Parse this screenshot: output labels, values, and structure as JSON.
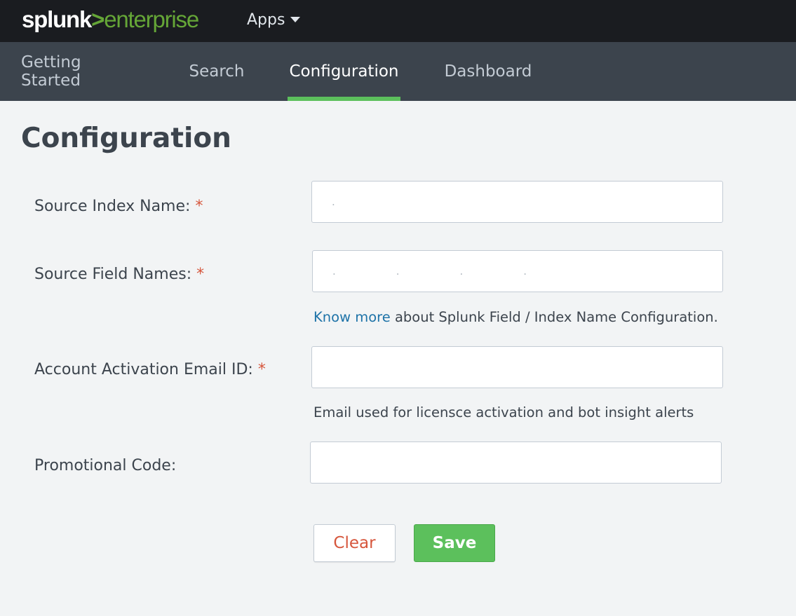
{
  "header": {
    "logo": {
      "part1": "splunk",
      "part2": ">",
      "part3": "enterprise"
    },
    "apps_label": "Apps"
  },
  "nav": {
    "tabs": [
      {
        "label": "Getting Started",
        "active": false
      },
      {
        "label": "Search",
        "active": false
      },
      {
        "label": "Configuration",
        "active": true
      },
      {
        "label": "Dashboard",
        "active": false
      }
    ]
  },
  "page": {
    "title": "Configuration"
  },
  "form": {
    "source_index": {
      "label": "Source Index Name:",
      "required_mark": "*",
      "value": "."
    },
    "source_fields": {
      "label": "Source Field Names:",
      "required_mark": "*",
      "value": "...."
    },
    "fields_help": {
      "link": "Know more",
      "text": " about Splunk Field / Index Name Configuration."
    },
    "email": {
      "label": "Account Activation Email ID:",
      "required_mark": "*",
      "value": ""
    },
    "email_help": "Email used for licensce activation and bot insight alerts",
    "promo": {
      "label": "Promotional Code:",
      "value": ""
    },
    "clear_label": "Clear",
    "save_label": "Save"
  },
  "colors": {
    "topbar_bg": "#1a1c20",
    "navbar_bg": "#3c444d",
    "accent_green": "#5cc05c",
    "required_red": "#d6563c",
    "link_blue": "#1e73a8",
    "page_bg": "#f2f4f5"
  }
}
